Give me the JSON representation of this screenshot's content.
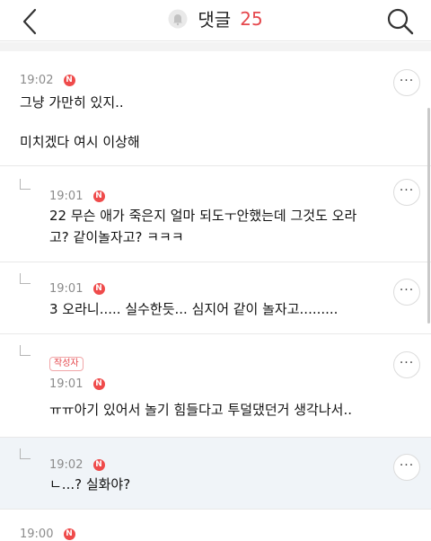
{
  "header": {
    "title": "댓글",
    "count": "25",
    "icons": {
      "back": "chevron-left-icon",
      "bell": "bell-icon",
      "search": "search-icon"
    },
    "accent": "#e5484d"
  },
  "comments": [
    {
      "time": "19:02",
      "badge": "N",
      "line1": "그냥 가만히 있지..",
      "line2": "미치겠다 여시 이상해",
      "more": "···"
    },
    {
      "time": "19:01",
      "badge": "N",
      "line1": "22 무슨 애가 죽은지 얼마 되도ㅜ안했는데 그것도 오라",
      "line2": "고? 같이놀자고? ㅋㅋㅋ",
      "more": "···"
    },
    {
      "time": "19:01",
      "badge": "N",
      "line1": "3 오라니..... 실수한듯... 심지어 같이 놀자고.........",
      "more": "···"
    },
    {
      "author_tag": "작성자",
      "time": "19:01",
      "badge": "N",
      "line1": "ㅠㅠ아기 있어서 놀기 힘들다고 투덜댔던거 생각나서..",
      "more": "···"
    },
    {
      "time": "19:02",
      "badge": "N",
      "line1": "ㄴ...? 실화야?",
      "more": "···"
    },
    {
      "time": "19:00",
      "badge": "N"
    }
  ],
  "colors": {
    "badge": "#ef4b4b",
    "highlight_bg": "#f0f4f8",
    "time": "#8c8c8c"
  }
}
